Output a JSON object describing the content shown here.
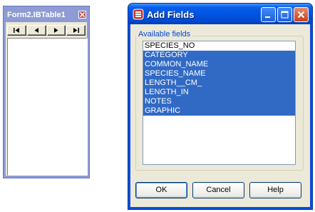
{
  "ibtable_form": {
    "title": "Form2.IBTable1",
    "nav_buttons": [
      {
        "name": "first-record-button",
        "icon": "first-record-icon"
      },
      {
        "name": "prior-record-button",
        "icon": "prior-record-icon"
      },
      {
        "name": "next-record-button",
        "icon": "next-record-icon"
      },
      {
        "name": "last-record-button",
        "icon": "last-record-icon"
      }
    ]
  },
  "add_fields_dialog": {
    "title": "Add Fields",
    "group_label": "Available fields",
    "fields": [
      {
        "label": "SPECIES_NO",
        "selected": false
      },
      {
        "label": "CATEGORY",
        "selected": true
      },
      {
        "label": "COMMON_NAME",
        "selected": true
      },
      {
        "label": "SPECIES_NAME",
        "selected": true
      },
      {
        "label": "LENGTH__CM_",
        "selected": true
      },
      {
        "label": "LENGTH_IN",
        "selected": true
      },
      {
        "label": "NOTES",
        "selected": true
      },
      {
        "label": "GRAPHIC",
        "selected": true
      }
    ],
    "buttons": {
      "ok": "OK",
      "cancel": "Cancel",
      "help": "Help"
    }
  },
  "colors": {
    "xp_blue": "#0054e3",
    "selection": "#316ac5",
    "form_frame": "#8e9bd4",
    "dialog_face": "#ece9d8"
  }
}
